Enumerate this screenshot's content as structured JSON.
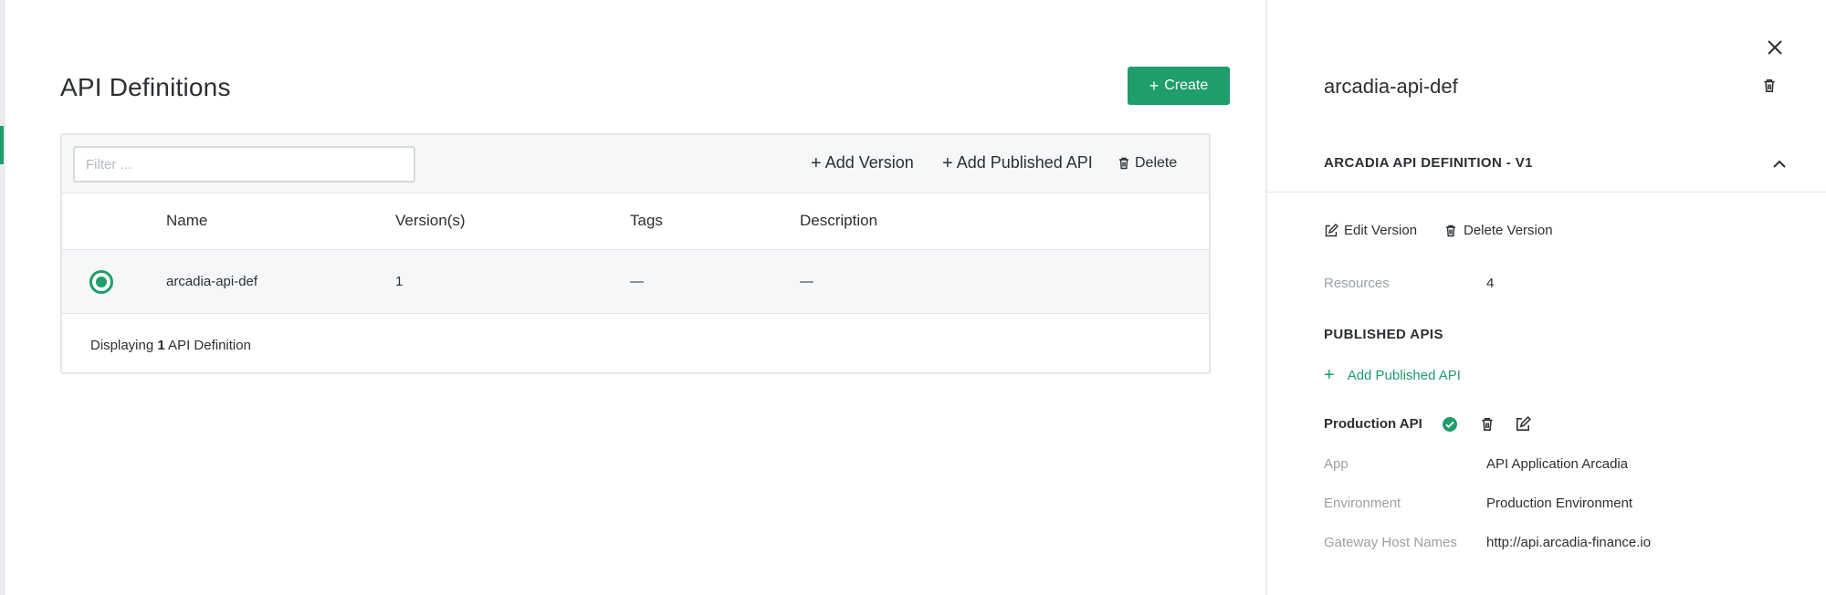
{
  "main": {
    "title": "API Definitions",
    "create_label": "Create",
    "filter_placeholder": "Filter ...",
    "toolbar": {
      "add_version": "Add Version",
      "add_published_api": "Add Published API",
      "delete": "Delete"
    },
    "table": {
      "columns": [
        "Name",
        "Version(s)",
        "Tags",
        "Description"
      ],
      "rows": [
        {
          "name": "arcadia-api-def",
          "versions": "1",
          "tags": "—",
          "description": "—"
        }
      ]
    },
    "footer": {
      "prefix": "Displaying ",
      "count": "1",
      "suffix": " API Definition"
    }
  },
  "panel": {
    "title": "arcadia-api-def",
    "section": "ARCADIA API DEFINITION - V1",
    "edit_version": "Edit Version",
    "delete_version": "Delete Version",
    "resources_label": "Resources",
    "resources_value": "4",
    "published_apis_heading": "PUBLISHED APIS",
    "add_published_api": "Add Published API",
    "production": {
      "name": "Production API",
      "app_label": "App",
      "app_value": "API Application Arcadia",
      "env_label": "Environment",
      "env_value": "Production Environment",
      "hosts_label": "Gateway Host Names",
      "hosts_value": "http://api.arcadia-finance.io"
    }
  },
  "colors": {
    "accent": "#1f9d6a",
    "text": "#2b2f33",
    "muted": "#9aa0a6",
    "border": "#e3e6ea"
  }
}
